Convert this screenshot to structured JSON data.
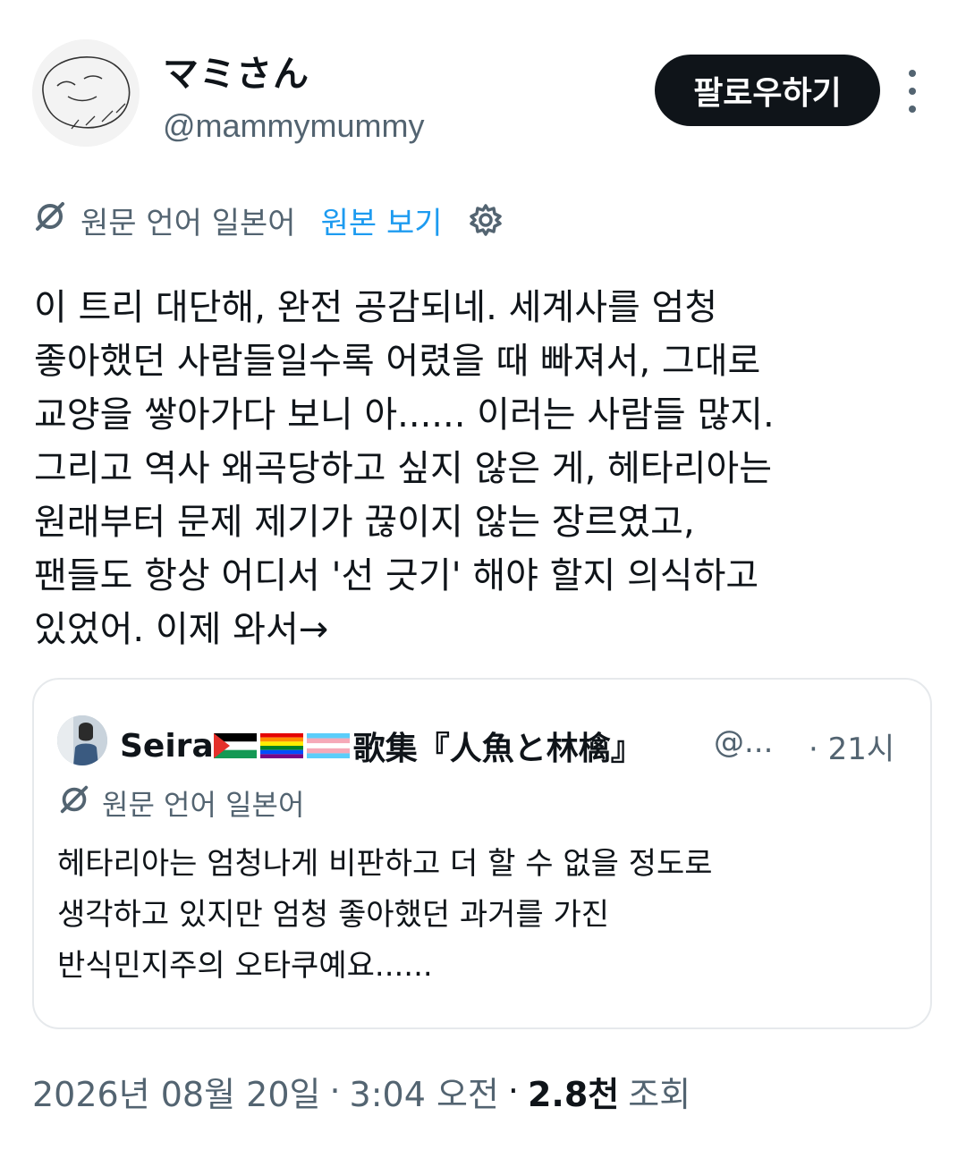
{
  "author": {
    "display_name": "マミさん",
    "handle": "@mammymummy"
  },
  "actions": {
    "follow_label": "팔로우하기",
    "more_icon": "more-vertical-icon"
  },
  "translation": {
    "original_language_label": "원문 언어 일본어",
    "view_original_label": "원본 보기",
    "translate_icon": "translate-icon",
    "settings_icon": "gear-icon"
  },
  "tweet": {
    "text": "이 트리 대단해, 완전 공감되네. 세계사를 엄청\n좋아했던 사람들일수록 어렸을 때 빠져서, 그대로\n교양을 쌓아가다 보니 아...... 이러는 사람들 많지.\n그리고 역사 왜곡당하고 싶지 않은 게, 헤타리아는\n원래부터 문제 제기가 끊이지 않는 장르였고,\n팬들도 항상 어디서 '선 긋기' 해야 할지 의식하고\n있었어. 이제 와서→"
  },
  "quote": {
    "name": "Seira",
    "name_suffix": "歌集『人魚と林檎』",
    "flags": [
      "palestine-flag",
      "rainbow-flag",
      "transgender-flag"
    ],
    "handle": "@...",
    "time": "· 21시",
    "original_language_label": "원문 언어 일본어",
    "text": "헤타리아는 엄청나게 비판하고 더 할 수 없을 정도로\n생각하고 있지만 엄청 좋아했던 과거를 가진\n반식민지주의 오타쿠예요......"
  },
  "meta": {
    "date": "2026년 08월 20일",
    "sep1": "·",
    "time": "3:04 오전",
    "sep2": "·",
    "views_count": "2.8천",
    "views_label": "조회"
  }
}
